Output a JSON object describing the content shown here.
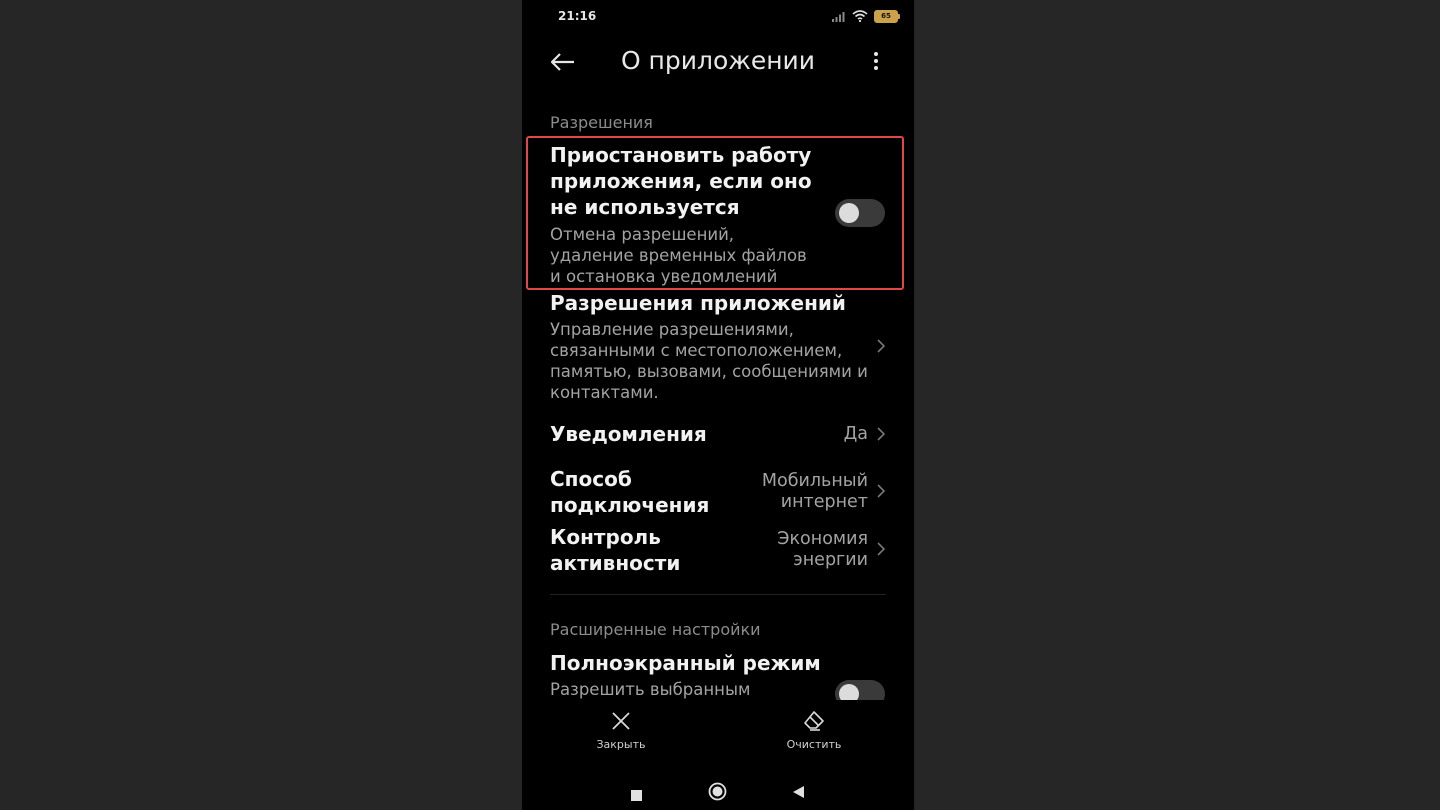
{
  "status_bar": {
    "time": "21:16",
    "battery": "65",
    "icons": [
      "signal-icon",
      "wifi-icon",
      "battery-icon"
    ]
  },
  "header": {
    "title": "О приложении",
    "back_icon": "back-arrow-icon",
    "more_icon": "more-vertical-icon"
  },
  "permissions_section": {
    "label": "Разрешения"
  },
  "pause_app": {
    "title_lines": [
      "Приостановить работу",
      "приложения, если оно",
      "не используется"
    ],
    "subtitle_lines": [
      "Отмена разрешений,",
      "удаление временных файлов",
      "и остановка уведомлений"
    ],
    "toggle_on": false
  },
  "app_permissions": {
    "title": "Разрешения приложений",
    "subtitle_lines": [
      "Управление разрешениями,",
      "связанными с местоположением,",
      "памятью, вызовами, сообщениями и",
      "контактами."
    ]
  },
  "notifications": {
    "title": "Уведомления",
    "value": "Да"
  },
  "connection": {
    "title_lines": [
      "Способ",
      "подключения"
    ],
    "value_lines": [
      "Мобильный",
      "интернет"
    ]
  },
  "activity": {
    "title_lines": [
      "Контроль",
      "активности"
    ],
    "value_lines": [
      "Экономия",
      "энергии"
    ]
  },
  "advanced_section": {
    "label": "Расширенные настройки"
  },
  "fullscreen": {
    "title": "Полноэкранный режим",
    "subtitle": "Разрешить выбранным",
    "toggle_on": false
  },
  "bottom_actions": {
    "close_label": "Закрыть",
    "clear_label": "Очистить"
  },
  "navigation": {
    "icons": [
      "recents-square-icon",
      "home-circle-icon",
      "back-triangle-icon"
    ]
  },
  "colors": {
    "highlight": "#e04848",
    "background": "#000000",
    "accent_battery": "#c9a24a"
  }
}
